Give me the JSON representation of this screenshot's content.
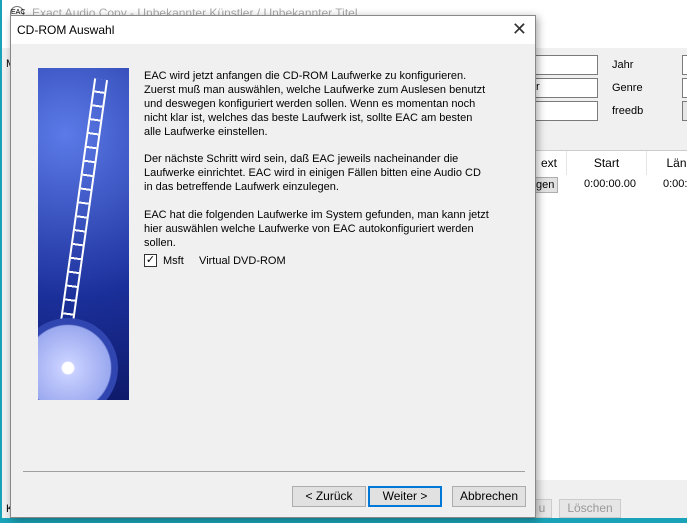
{
  "app": {
    "title": "Exact Audio Copy  -  Unbekannter Künstler / Unbekannter Titel",
    "icon_text": "EAC",
    "fields": [
      {
        "label": "Jahr"
      },
      {
        "label": "Genre"
      },
      {
        "label": "freedb"
      }
    ],
    "second_field_value": "r",
    "table": {
      "headers": [
        "ext",
        "Start",
        "Län"
      ],
      "row": {
        "text_button": "gen",
        "start": "0:00:00.00",
        "length": "0:00:"
      }
    },
    "left_labels": {
      "m": "M",
      "k": "K"
    },
    "bottom_buttons": [
      "u",
      "Löschen"
    ]
  },
  "dialog": {
    "title": "CD-ROM Auswahl",
    "paragraphs": [
      "EAC wird jetzt anfangen die CD-ROM Laufwerke zu konfigurieren. Zuerst muß man auswählen, welche Laufwerke zum Auslesen benutzt und deswegen konfiguriert werden sollen. Wenn es momentan noch nicht klar ist, welches das beste Laufwerk ist, sollte EAC am besten alle Laufwerke einstellen.",
      "Der nächste Schritt wird sein, daß EAC jeweils nacheinander die Laufwerke einrichtet. EAC wird in einigen Fällen bitten eine Audio CD in das betreffende Laufwerk einzulegen.",
      "EAC hat die folgenden Laufwerke im System gefunden, man kann jetzt hier auswählen welche Laufwerke von EAC autokonfiguriert werden sollen."
    ],
    "drive": {
      "label": "Msft     Virtual DVD-ROM",
      "checked": true,
      "check_mark": "✓"
    },
    "close_glyph": "✕",
    "buttons": {
      "back": "< Zurück",
      "next": "Weiter >",
      "cancel": "Abbrechen"
    }
  }
}
